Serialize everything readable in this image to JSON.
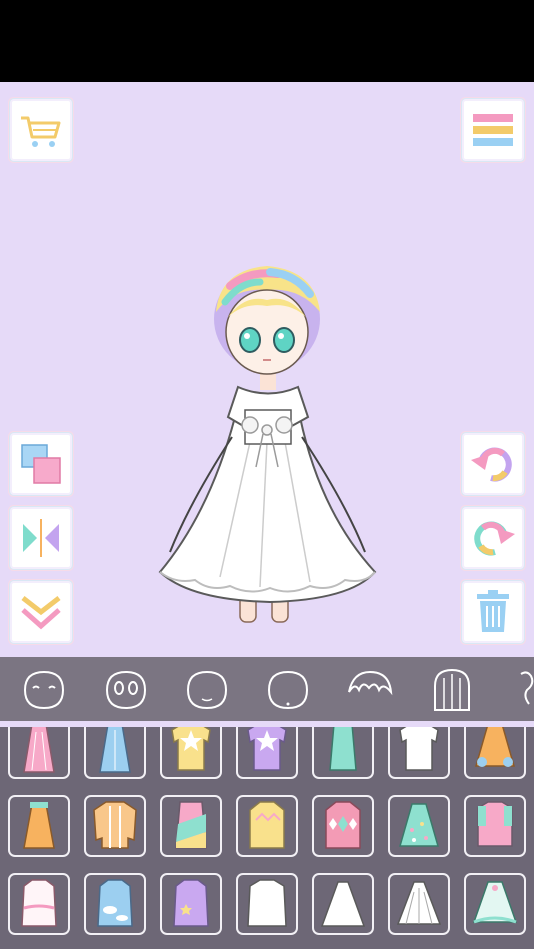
{
  "toolbar": {
    "left": [
      {
        "name": "cart-button",
        "icon": "shopping-cart-icon"
      },
      {
        "name": "layer-button",
        "icon": "layers-icon"
      },
      {
        "name": "flip-button",
        "icon": "flip-horizontal-icon"
      },
      {
        "name": "move-down-button",
        "icon": "chevron-double-down-icon"
      }
    ],
    "right": [
      {
        "name": "menu-button",
        "icon": "menu-icon"
      },
      {
        "name": "undo-button",
        "icon": "undo-icon"
      },
      {
        "name": "redo-button",
        "icon": "redo-icon"
      },
      {
        "name": "delete-button",
        "icon": "trash-icon"
      }
    ]
  },
  "categories": [
    "face-shape",
    "eyes",
    "face-blank",
    "face-outline",
    "bangs-hair",
    "back-hair",
    "accessory"
  ],
  "items": [
    [
      "pink-skirt",
      "blue-skirt",
      "yellow-star-tee",
      "purple-star-tee",
      "mint-tank",
      "white-tee",
      "orange-flower-dress"
    ],
    [
      "orange-dress",
      "striped-shirt",
      "pastel-dress",
      "yellow-sweater",
      "pink-argyle-sweater",
      "mint-polka-dress",
      "pink-mint-dress"
    ],
    [
      "pink-lace-dress",
      "blue-cloud-dress",
      "purple-star-dress",
      "white-shirt-dress",
      "white-gown",
      "white-frilly-gown",
      "mint-tulle-dress"
    ]
  ],
  "colors": {
    "stage": "#e6daf8",
    "categoryBar": "#7b7582",
    "itemGrid": "#6d6776",
    "cellBorder": "#f2f0f5",
    "pink": "#f7a9c8",
    "blue": "#9ccff0",
    "mint": "#8ee0cf",
    "yellow": "#f9e18c",
    "purple": "#c9a8f0",
    "orange": "#f7b25f"
  }
}
